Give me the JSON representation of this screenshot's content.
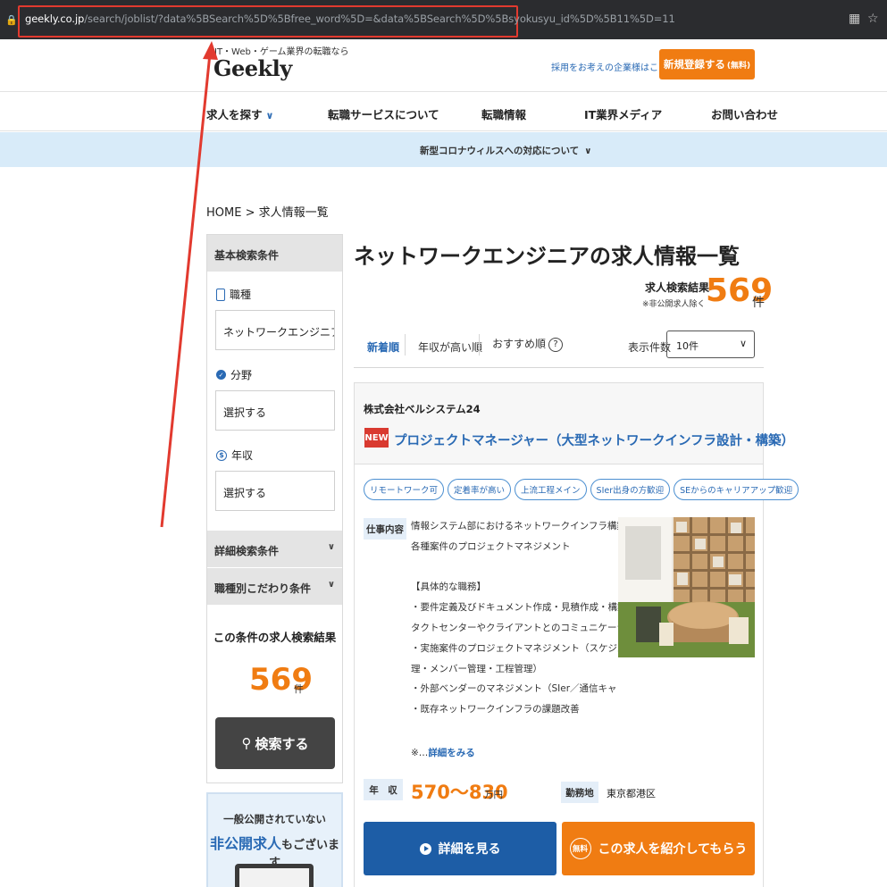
{
  "browser": {
    "url_host": "geekly.co.jp",
    "url_path": "/search/joblist/?data%5BSearch%5D%5Bfree_word%5D=&data%5BSearch%5D%5Bsyokusyu_id%5D%5B11%5D=11"
  },
  "header": {
    "tagline": "IT・Web・ゲーム業界の転職なら",
    "logo": "Geekly",
    "corp_link": "採用をお考えの企業様はこちら",
    "register_label": "新規登録する",
    "register_free": "(無料)"
  },
  "nav": {
    "items": [
      "求人を探す",
      "転職サービスについて",
      "転職情報",
      "IT業界メディア",
      "お問い合わせ"
    ]
  },
  "corona_banner": "新型コロナウィルスへの対応について",
  "breadcrumb": "HOME > 求人情報一覧",
  "sidebar": {
    "basic_title": "基本検索条件",
    "fields": [
      {
        "label": "職種",
        "value": "ネットワークエンジニア"
      },
      {
        "label": "分野",
        "value": "選択する"
      },
      {
        "label": "年収",
        "value": "選択する"
      }
    ],
    "detail_title": "詳細検索条件",
    "job_specific_title": "職種別こだわり条件",
    "result_title": "この条件の求人検索結果",
    "result_count": "569",
    "result_unit": "件",
    "search_button": "検索する"
  },
  "nonpublic_banner": {
    "line1": "一般公開されていない",
    "line2_highlight": "非公開求人",
    "line2_rest": "もございます"
  },
  "main": {
    "title": "ネットワークエンジニアの求人情報一覧",
    "result_label": "求人検索結果",
    "result_note": "※非公開求人除く",
    "result_count": "569",
    "result_unit": "件",
    "sort": {
      "options": [
        "新着順",
        "年収が高い順",
        "おすすめ順"
      ],
      "active_index": 0,
      "per_page_label": "表示件数",
      "per_page_value": "10件"
    }
  },
  "job": {
    "company": "株式会社ベルシステム24",
    "new_badge": "NEW",
    "title": "プロジェクトマネージャー（大型ネットワークインフラ設計・構築）",
    "tags": [
      "リモートワーク可",
      "定着率が高い",
      "上流工程メイン",
      "SIer出身の方歓迎",
      "SEからのキャリアアップ歓迎"
    ],
    "description_label": "仕事内容",
    "description_lines": [
      "情報システム部におけるネットワークインフラ構築に関する",
      "各種案件のプロジェクトマネジメント",
      "",
      "【具体的な職務】",
      "・要件定義及びドキュメント作成・見積作成・構築先のコン",
      "タクトセンターやクライアントとのコミュニケーション",
      "・実施案件のプロジェクトマネジメント（スケジュール管",
      "理・メンバー管理・工程管理）",
      "・外部ベンダーのマネジメント（SIer／通信キャリアなど）",
      "・既存ネットワークインフラの課題改善"
    ],
    "more_prefix": "※…",
    "more_link": "詳細をみる",
    "salary_label": "年　収",
    "salary": "570〜830",
    "salary_unit": "万円",
    "location_label": "勤務地",
    "location": "東京都港区",
    "detail_button": "詳細を見る",
    "free_badge": "無料",
    "intro_button": "この求人を紹介してもらう"
  },
  "colors": {
    "accent_orange": "#f07c12",
    "link_blue": "#2a6ab4",
    "button_blue": "#1d5da6",
    "annotation_red": "#e23a2f"
  }
}
